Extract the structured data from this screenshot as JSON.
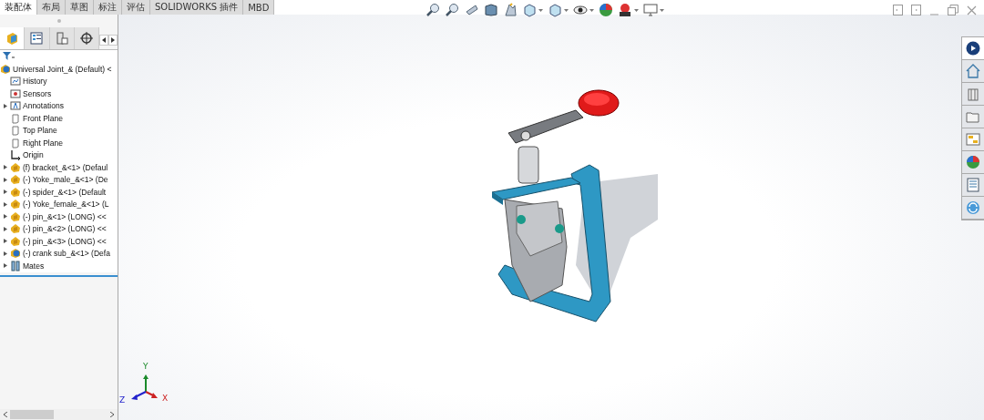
{
  "tabs": [
    {
      "label": "装配体",
      "selected": true
    },
    {
      "label": "布局",
      "selected": false
    },
    {
      "label": "草图",
      "selected": false
    },
    {
      "label": "标注",
      "selected": false
    },
    {
      "label": "评估",
      "selected": false
    },
    {
      "label": "SOLIDWORKS 插件",
      "selected": false
    },
    {
      "label": "MBD",
      "selected": false
    }
  ],
  "panel_tabs": [
    {
      "kind": "feature-manager",
      "selected": true
    },
    {
      "kind": "property-manager",
      "selected": false
    },
    {
      "kind": "configuration-manager",
      "selected": false
    },
    {
      "kind": "dimxpert",
      "selected": false
    }
  ],
  "tree": [
    {
      "label": "Universal Joint_& (Default) <",
      "kind": "assembly",
      "expandable": false
    },
    {
      "label": "History",
      "kind": "history",
      "expandable": false
    },
    {
      "label": "Sensors",
      "kind": "sensors",
      "expandable": false
    },
    {
      "label": "Annotations",
      "kind": "annotations",
      "expandable": true
    },
    {
      "label": "Front Plane",
      "kind": "plane",
      "expandable": false
    },
    {
      "label": "Top Plane",
      "kind": "plane",
      "expandable": false
    },
    {
      "label": "Right Plane",
      "kind": "plane",
      "expandable": false
    },
    {
      "label": "Origin",
      "kind": "origin",
      "expandable": false
    },
    {
      "label": "(f) bracket_&<1> (Defaul",
      "kind": "part",
      "expandable": true
    },
    {
      "label": "(-) Yoke_male_&<1> (De",
      "kind": "part",
      "expandable": true
    },
    {
      "label": "(-) spider_&<1> (Default",
      "kind": "part",
      "expandable": true
    },
    {
      "label": "(-) Yoke_female_&<1> (L",
      "kind": "part",
      "expandable": true
    },
    {
      "label": "(-) pin_&<1> (LONG) <<",
      "kind": "part",
      "expandable": true
    },
    {
      "label": "(-) pin_&<2> (LONG) <<",
      "kind": "part",
      "expandable": true
    },
    {
      "label": "(-) pin_&<3> (LONG) <<",
      "kind": "part",
      "expandable": true
    },
    {
      "label": "(-) crank sub_&<1> (Defa",
      "kind": "subassembly",
      "expandable": true
    },
    {
      "label": "Mates",
      "kind": "mates",
      "expandable": true
    }
  ],
  "triad": {
    "x": "X",
    "y": "Y",
    "z": "Z"
  }
}
